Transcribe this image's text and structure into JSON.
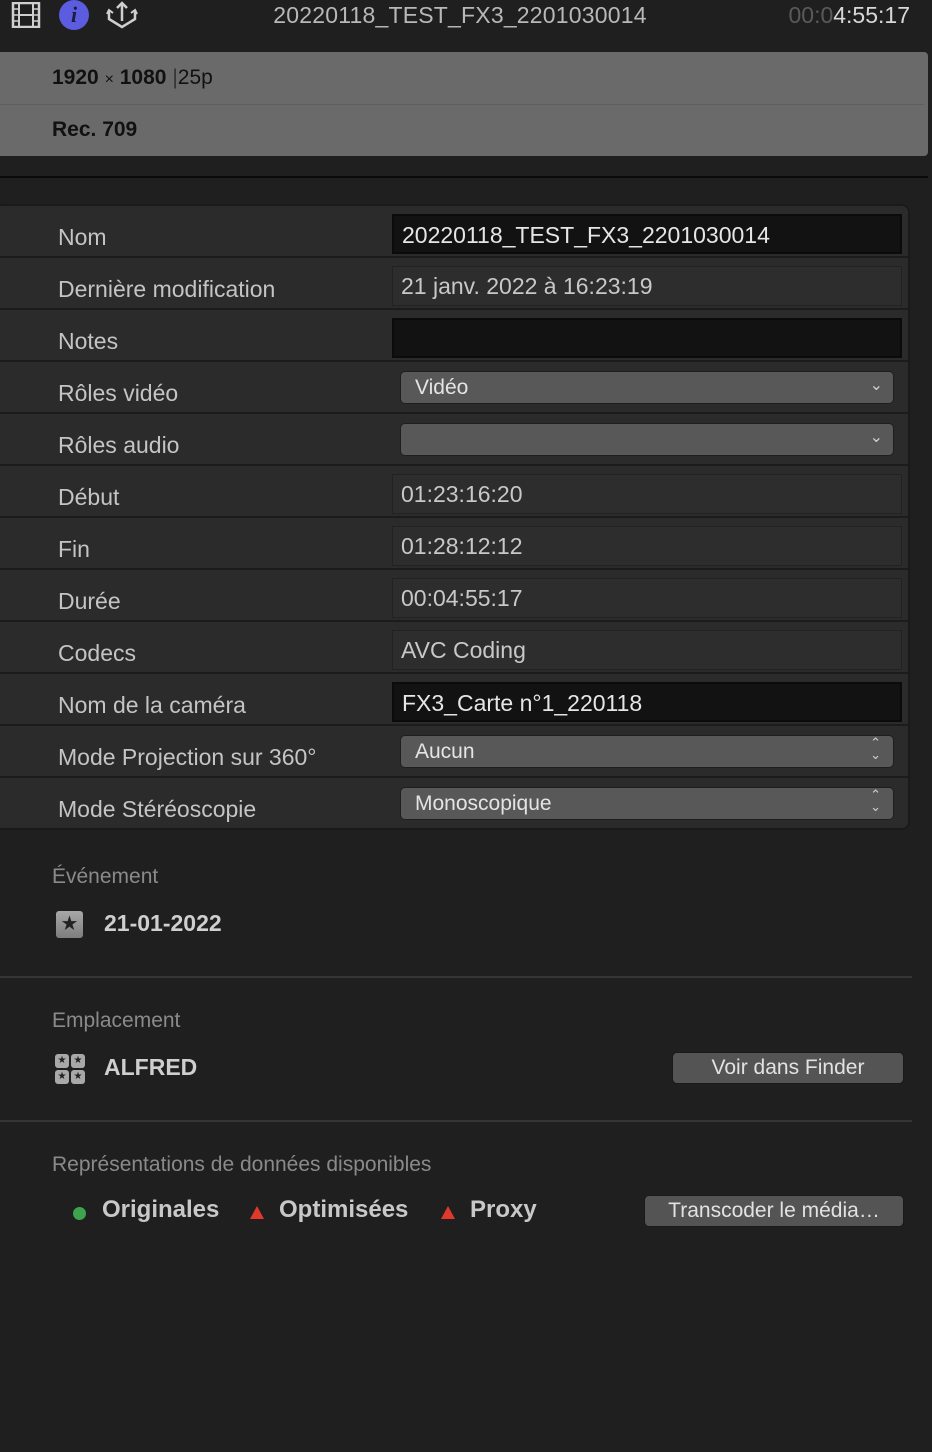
{
  "header": {
    "icons": [
      "film-icon",
      "info-icon",
      "share-icon"
    ],
    "title": "20220118_TEST_FX3_2201030014",
    "timecode_dim": "00:0",
    "timecode_bright": "4:55:17",
    "info_accent": "#5b5ce0"
  },
  "format": {
    "width": "1920",
    "times": "×",
    "height": "1080",
    "separator": "|",
    "framerate": "25p",
    "colorspace": "Rec. 709"
  },
  "properties": [
    {
      "label": "Nom",
      "value": "20220118_TEST_FX3_2201030014",
      "kind": "text-input"
    },
    {
      "label": "Dernière modification",
      "value": "21 janv. 2022 à 16:23:19",
      "kind": "read-only"
    },
    {
      "label": "Notes",
      "value": "",
      "kind": "text-input"
    },
    {
      "label": "Rôles vidéo",
      "value": "Vidéo",
      "kind": "popup"
    },
    {
      "label": "Rôles audio",
      "value": "",
      "kind": "popup"
    },
    {
      "label": "Début",
      "value": "01:23:16:20",
      "kind": "read-only"
    },
    {
      "label": "Fin",
      "value": "01:28:12:12",
      "kind": "read-only"
    },
    {
      "label": "Durée",
      "value": "00:04:55:17",
      "kind": "read-only"
    },
    {
      "label": "Codecs",
      "value": "AVC Coding",
      "kind": "read-only"
    },
    {
      "label": "Nom de la caméra",
      "value": "FX3_Carte n°1_220118",
      "kind": "text-input"
    },
    {
      "label": "Mode Projection sur 360°",
      "value": "Aucun",
      "kind": "stepper-popup"
    },
    {
      "label": "Mode Stéréoscopie",
      "value": "Monoscopique",
      "kind": "stepper-popup"
    }
  ],
  "event": {
    "label": "Événement",
    "value": "21-01-2022"
  },
  "location": {
    "label": "Emplacement",
    "value": "ALFRED",
    "button": "Voir dans Finder"
  },
  "representations": {
    "label": "Représentations de données disponibles",
    "items": [
      {
        "name": "Originales",
        "status": "available",
        "color": "#3fa34d"
      },
      {
        "name": "Optimisées",
        "status": "missing",
        "color": "#e0392b"
      },
      {
        "name": "Proxy",
        "status": "missing",
        "color": "#e0392b"
      }
    ],
    "button": "Transcoder le média…"
  }
}
